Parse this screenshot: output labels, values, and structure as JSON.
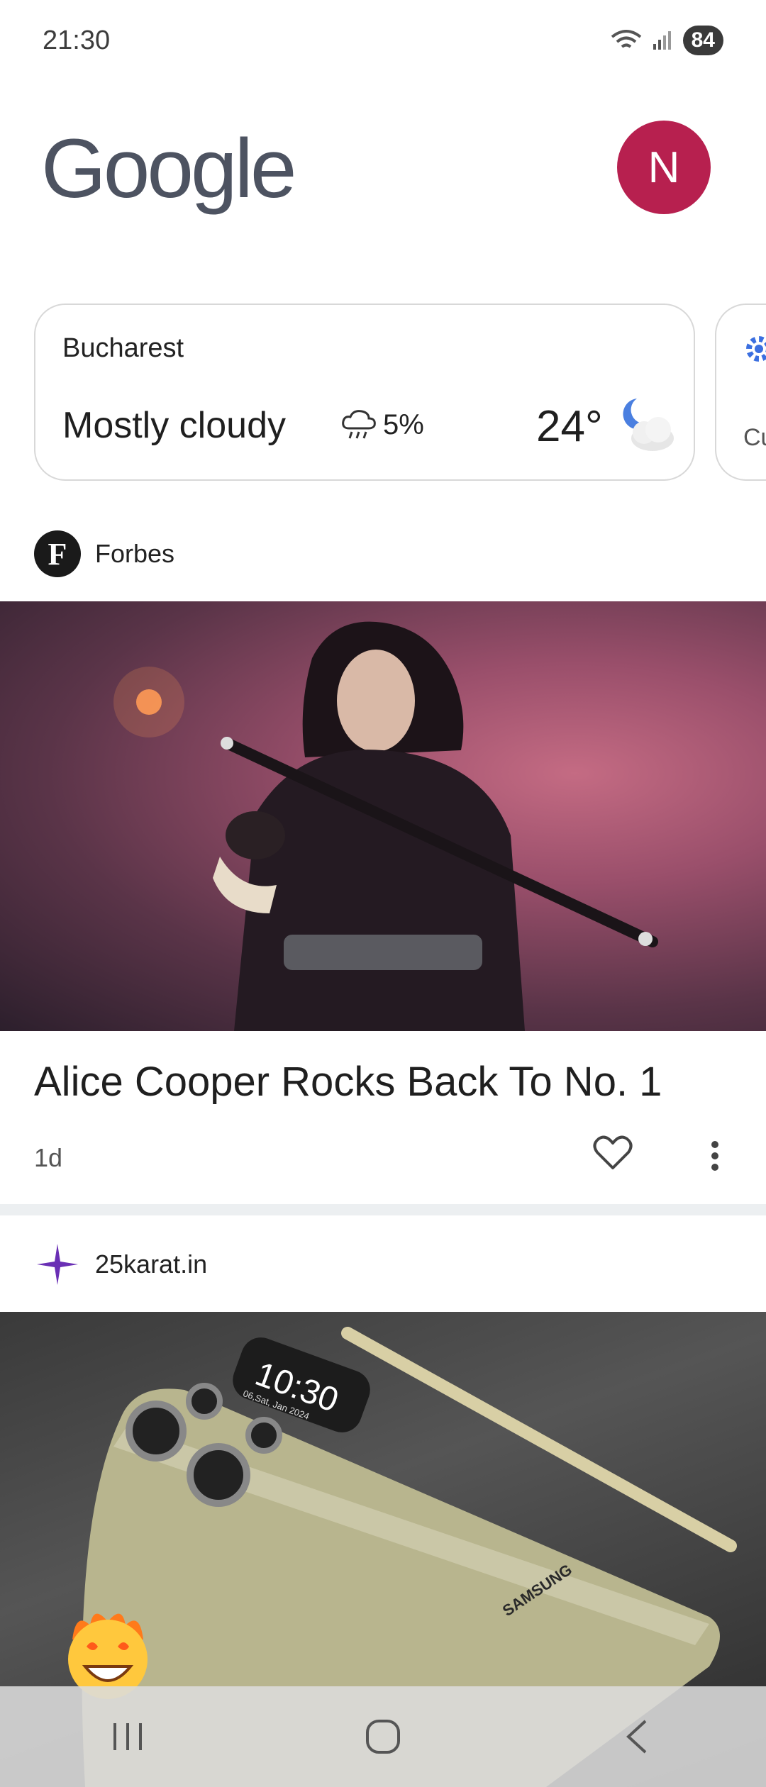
{
  "status_bar": {
    "time": "21:30",
    "battery": "84"
  },
  "header": {
    "logo": "Google",
    "avatar_initial": "N"
  },
  "weather": {
    "city": "Bucharest",
    "condition": "Mostly cloudy",
    "rain_chance": "5%",
    "temperature": "24°",
    "icon": "partly-cloudy-night-icon"
  },
  "next_card": {
    "peek_text": "Cu"
  },
  "articles": [
    {
      "source": "Forbes",
      "source_logo": "F",
      "headline": "Alice Cooper Rocks Back To No. 1",
      "age": "1d"
    },
    {
      "source": "25karat.in",
      "phone_time": "10:30",
      "phone_date": "06,Sat, Jan 2024",
      "brand": "SAMSUNG"
    }
  ],
  "nav": {
    "recents": "|||",
    "home": "○",
    "back": "<"
  }
}
